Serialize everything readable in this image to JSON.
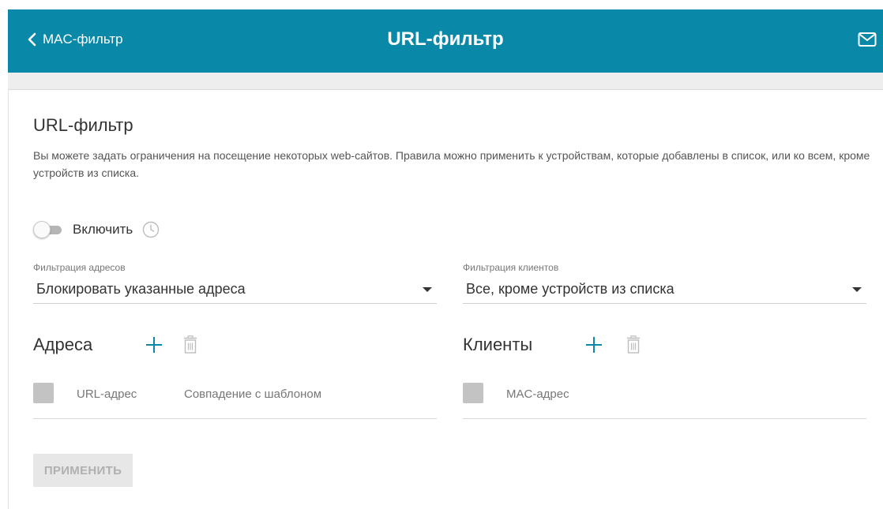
{
  "header": {
    "back_label": "MAC-фильтр",
    "title": "URL-фильтр",
    "icons": {
      "back": "chevron-left-icon",
      "mail": "mail-icon"
    }
  },
  "page": {
    "title": "URL-фильтр",
    "description": "Вы можете задать ограничения на посещение некоторых web-сайтов. Правила можно применить к устройствам, которые добавлены в список, или ко всем, кроме устройств из списка."
  },
  "enable": {
    "label": "Включить",
    "checked": false,
    "icon": "clock-icon"
  },
  "filters": {
    "address": {
      "label": "Фильтрация адресов",
      "value": "Блокировать указанные адреса"
    },
    "clients": {
      "label": "Фильтрация клиентов",
      "value": "Все, кроме устройств из списка"
    }
  },
  "addresses": {
    "title": "Адреса",
    "columns": [
      "URL-адрес",
      "Совпадение с шаблоном"
    ]
  },
  "clients": {
    "title": "Клиенты",
    "columns": [
      "MAC-адрес"
    ]
  },
  "apply_label": "ПРИМЕНИТЬ",
  "colors": {
    "header_bg": "#0a88a8",
    "accent": "#0a88a8",
    "disabled_icon": "#bdbdbd",
    "checkbox": "#c3c3c3"
  }
}
